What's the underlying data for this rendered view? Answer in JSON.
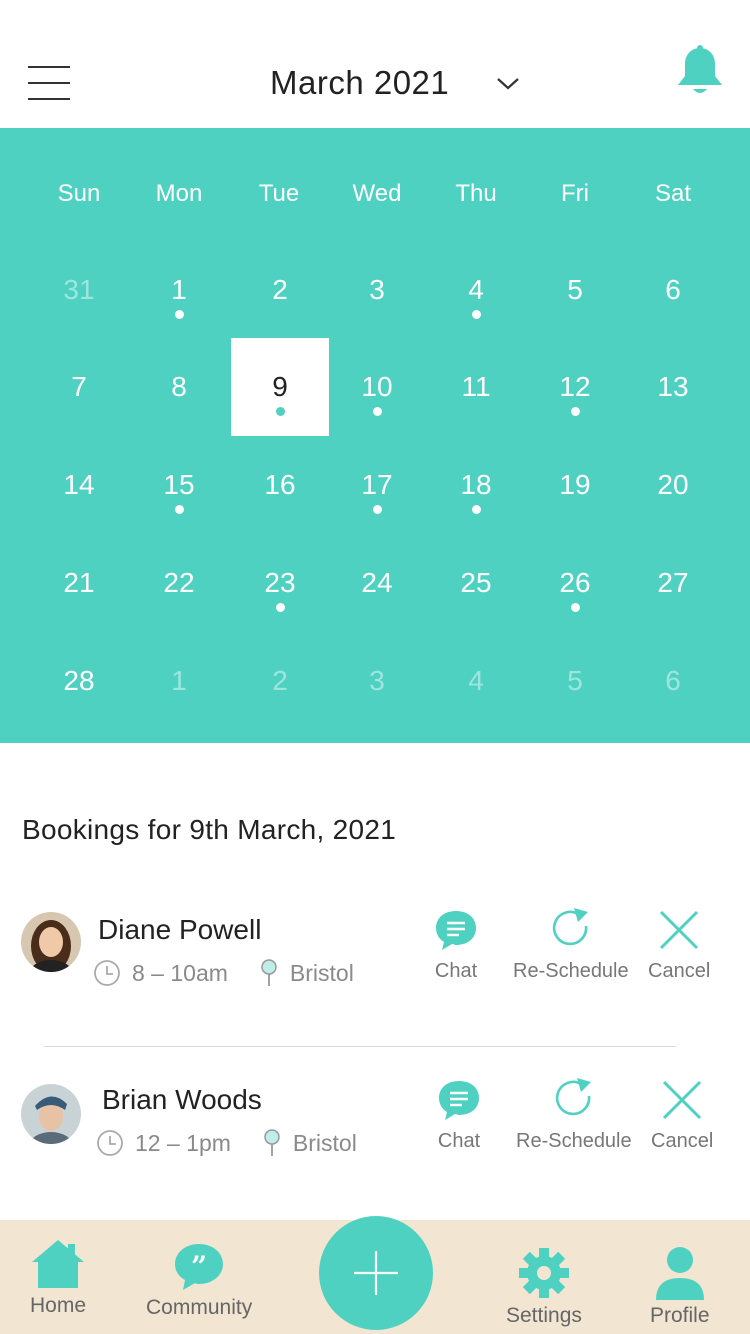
{
  "header": {
    "month_title": "March 2021",
    "menu_icon": "hamburger-menu-icon",
    "dropdown_icon": "chevron-down-icon",
    "notification_icon": "bell-icon"
  },
  "colors": {
    "accent": "#4fd1c2",
    "nav_background": "#f2e6d3"
  },
  "calendar": {
    "weekdays": [
      "Sun",
      "Mon",
      "Tue",
      "Wed",
      "Thu",
      "Fri",
      "Sat"
    ],
    "selected_day": "9",
    "weeks": [
      [
        {
          "d": "31",
          "faded": true,
          "dot": false
        },
        {
          "d": "1",
          "faded": false,
          "dot": true
        },
        {
          "d": "2",
          "faded": false,
          "dot": false
        },
        {
          "d": "3",
          "faded": false,
          "dot": false
        },
        {
          "d": "4",
          "faded": false,
          "dot": true
        },
        {
          "d": "5",
          "faded": false,
          "dot": false
        },
        {
          "d": "6",
          "faded": false,
          "dot": false
        }
      ],
      [
        {
          "d": "7",
          "faded": false,
          "dot": false
        },
        {
          "d": "8",
          "faded": false,
          "dot": false
        },
        {
          "d": "9",
          "faded": false,
          "dot": true
        },
        {
          "d": "10",
          "faded": false,
          "dot": true
        },
        {
          "d": "11",
          "faded": false,
          "dot": false
        },
        {
          "d": "12",
          "faded": false,
          "dot": true
        },
        {
          "d": "13",
          "faded": false,
          "dot": false
        }
      ],
      [
        {
          "d": "14",
          "faded": false,
          "dot": false
        },
        {
          "d": "15",
          "faded": false,
          "dot": true
        },
        {
          "d": "16",
          "faded": false,
          "dot": false
        },
        {
          "d": "17",
          "faded": false,
          "dot": true
        },
        {
          "d": "18",
          "faded": false,
          "dot": true
        },
        {
          "d": "19",
          "faded": false,
          "dot": false
        },
        {
          "d": "20",
          "faded": false,
          "dot": false
        }
      ],
      [
        {
          "d": "21",
          "faded": false,
          "dot": false
        },
        {
          "d": "22",
          "faded": false,
          "dot": false
        },
        {
          "d": "23",
          "faded": false,
          "dot": true
        },
        {
          "d": "24",
          "faded": false,
          "dot": false
        },
        {
          "d": "25",
          "faded": false,
          "dot": false
        },
        {
          "d": "26",
          "faded": false,
          "dot": true
        },
        {
          "d": "27",
          "faded": false,
          "dot": false
        }
      ],
      [
        {
          "d": "28",
          "faded": false,
          "dot": false
        },
        {
          "d": "1",
          "faded": true,
          "dot": false
        },
        {
          "d": "2",
          "faded": true,
          "dot": false
        },
        {
          "d": "3",
          "faded": true,
          "dot": false
        },
        {
          "d": "4",
          "faded": true,
          "dot": false
        },
        {
          "d": "5",
          "faded": true,
          "dot": false
        },
        {
          "d": "6",
          "faded": true,
          "dot": false
        }
      ]
    ]
  },
  "bookings": {
    "heading": "Bookings for 9th March, 2021",
    "items": [
      {
        "name": "Diane Powell",
        "time": "8 – 10am",
        "location": "Bristol"
      },
      {
        "name": "Brian Woods",
        "time": "12 – 1pm",
        "location": "Bristol"
      }
    ],
    "actions": {
      "chat": "Chat",
      "reschedule": "Re-Schedule",
      "cancel": "Cancel"
    }
  },
  "bottom_nav": {
    "home": "Home",
    "community": "Community",
    "settings": "Settings",
    "profile": "Profile",
    "add_icon": "plus-icon"
  }
}
